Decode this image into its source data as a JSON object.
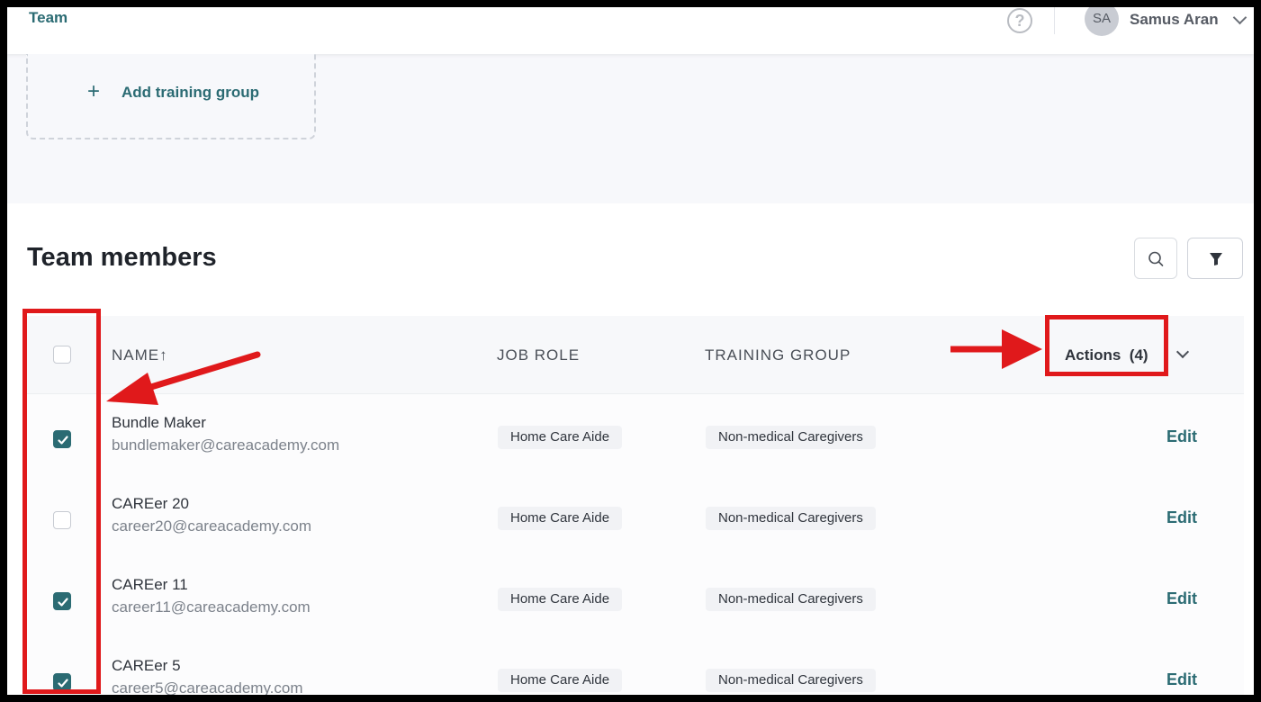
{
  "header": {
    "nav_label": "Team",
    "help_glyph": "?",
    "user_initials": "SA",
    "user_name": "Samus Aran"
  },
  "add_group": {
    "plus_glyph": "+",
    "label": "Add training group"
  },
  "members": {
    "title": "Team members",
    "columns": {
      "name": "NAME↑",
      "job_role": "JOB ROLE",
      "training_group": "TRAINING GROUP"
    },
    "actions_label": "Actions",
    "actions_count": "(4)",
    "rows": [
      {
        "name": "Bundle Maker",
        "email": "bundlemaker@careacademy.com",
        "job_role": "Home Care Aide",
        "training_group": "Non-medical Caregivers",
        "edit": "Edit",
        "checked": true
      },
      {
        "name": "CAREer 20",
        "email": "career20@careacademy.com",
        "job_role": "Home Care Aide",
        "training_group": "Non-medical Caregivers",
        "edit": "Edit",
        "checked": false
      },
      {
        "name": "CAREer 11",
        "email": "career11@careacademy.com",
        "job_role": "Home Care Aide",
        "training_group": "Non-medical Caregivers",
        "edit": "Edit",
        "checked": true
      },
      {
        "name": "CAREer 5",
        "email": "career5@careacademy.com",
        "job_role": "Home Care Aide",
        "training_group": "Non-medical Caregivers",
        "edit": "Edit",
        "checked": true
      }
    ]
  },
  "colors": {
    "accent": "#2b6b73",
    "annotation_red": "#e0191b"
  }
}
